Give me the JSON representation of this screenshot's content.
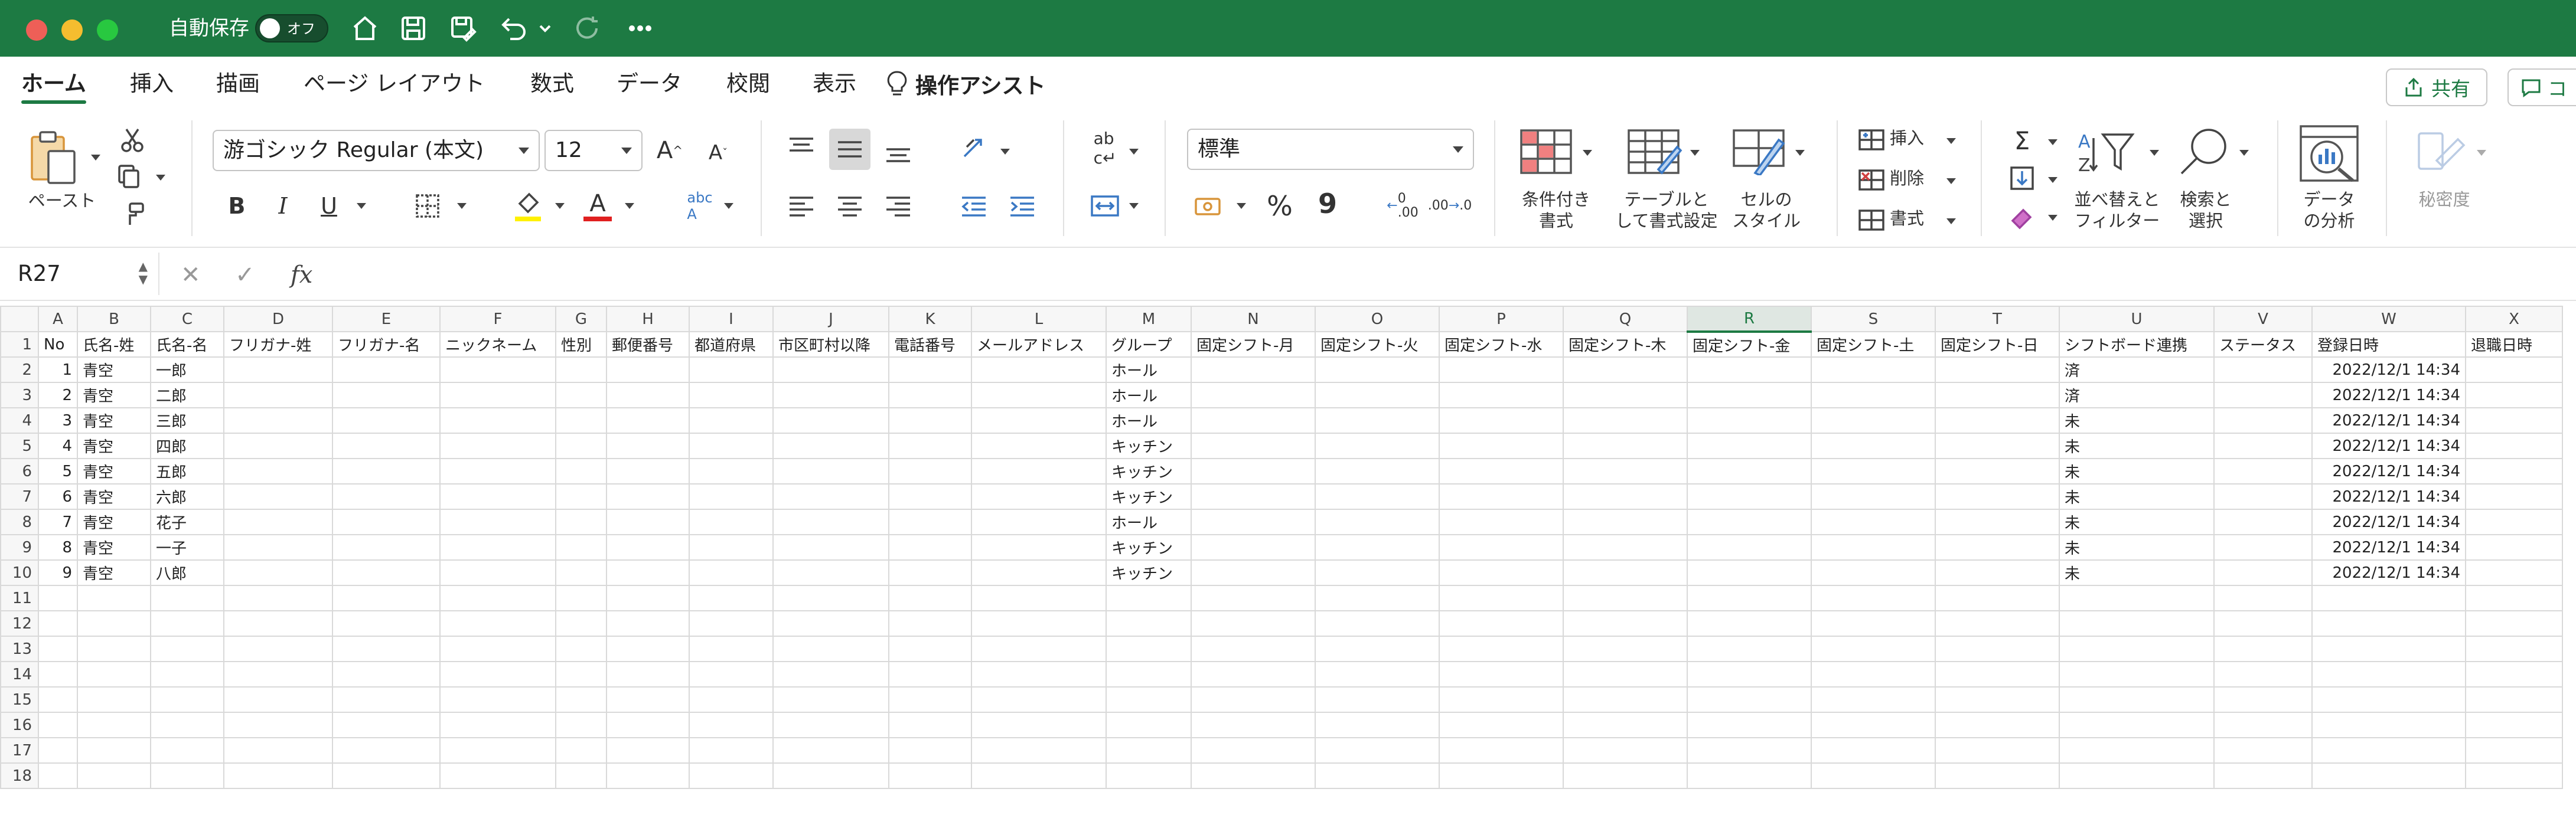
{
  "titlebar": {
    "autosave_label": "自動保存",
    "autosave_state": "オフ"
  },
  "tabs": [
    {
      "label": "ホーム",
      "active": true
    },
    {
      "label": "挿入"
    },
    {
      "label": "描画"
    },
    {
      "label": "ページ レイアウト"
    },
    {
      "label": "数式"
    },
    {
      "label": "データ"
    },
    {
      "label": "校閲"
    },
    {
      "label": "表示"
    }
  ],
  "tab_ops": "操作アシスト",
  "share_label": "共有",
  "comment_label": "コ",
  "ribbon": {
    "paste": "ペースト",
    "font_name": "游ゴシック Regular (本文)",
    "font_size": "12",
    "bold": "B",
    "italic": "I",
    "underline": "U",
    "number_format": "標準",
    "percent": "%",
    "comma": "9",
    "conditional": "条件付き\n書式",
    "table_format": "テーブルと\nして書式設定",
    "cell_style": "セルの\nスタイル",
    "insert": "挿入",
    "delete": "削除",
    "format": "書式",
    "sort_filter": "並べ替えと\nフィルター",
    "find_select": "検索と\n選択",
    "analyze": "データ\nの分析",
    "sensitivity": "秘密度"
  },
  "formula": {
    "name_box": "R27",
    "fx": "fx",
    "value": ""
  },
  "grid": {
    "columns": [
      "A",
      "B",
      "C",
      "D",
      "E",
      "F",
      "G",
      "H",
      "I",
      "J",
      "K",
      "L",
      "M",
      "N",
      "O",
      "P",
      "Q",
      "R",
      "S",
      "T",
      "U",
      "V",
      "W",
      "X"
    ],
    "selected_column": "R",
    "header_row": [
      "No",
      "氏名-姓",
      "氏名-名",
      "フリガナ-姓",
      "フリガナ-名",
      "ニックネーム",
      "性別",
      "郵便番号",
      "都道府県",
      "市区町村以降",
      "電話番号",
      "メールアドレス",
      "グループ",
      "固定シフト-月",
      "固定シフト-火",
      "固定シフト-水",
      "固定シフト-木",
      "固定シフト-金",
      "固定シフト-土",
      "固定シフト-日",
      "シフトボード連携",
      "ステータス",
      "登録日時",
      "退職日時"
    ],
    "rows": [
      {
        "no": "1",
        "sei": "青空",
        "mei": "一郎",
        "group": "ホール",
        "link": "済",
        "date": "2022/12/1 14:34"
      },
      {
        "no": "2",
        "sei": "青空",
        "mei": "二郎",
        "group": "ホール",
        "link": "済",
        "date": "2022/12/1 14:34"
      },
      {
        "no": "3",
        "sei": "青空",
        "mei": "三郎",
        "group": "ホール",
        "link": "未",
        "date": "2022/12/1 14:34"
      },
      {
        "no": "4",
        "sei": "青空",
        "mei": "四郎",
        "group": "キッチン",
        "link": "未",
        "date": "2022/12/1 14:34"
      },
      {
        "no": "5",
        "sei": "青空",
        "mei": "五郎",
        "group": "キッチン",
        "link": "未",
        "date": "2022/12/1 14:34"
      },
      {
        "no": "6",
        "sei": "青空",
        "mei": "六郎",
        "group": "キッチン",
        "link": "未",
        "date": "2022/12/1 14:34"
      },
      {
        "no": "7",
        "sei": "青空",
        "mei": "花子",
        "group": "ホール",
        "link": "未",
        "date": "2022/12/1 14:34"
      },
      {
        "no": "8",
        "sei": "青空",
        "mei": "一子",
        "group": "キッチン",
        "link": "未",
        "date": "2022/12/1 14:34"
      },
      {
        "no": "9",
        "sei": "青空",
        "mei": "八郎",
        "group": "キッチン",
        "link": "未",
        "date": "2022/12/1 14:34"
      }
    ],
    "row_numbers": [
      "1",
      "2",
      "3",
      "4",
      "5",
      "6",
      "7",
      "8",
      "9",
      "10",
      "11",
      "12",
      "13",
      "14",
      "15",
      "16",
      "17",
      "18"
    ]
  },
  "colors": {
    "titlebar": "#1d7a43",
    "accent": "#1d7a43"
  }
}
